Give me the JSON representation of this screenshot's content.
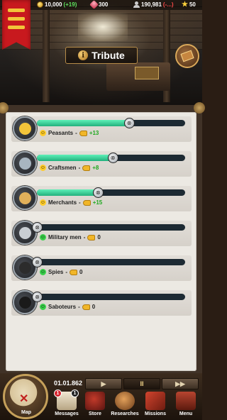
{
  "top_bar": {
    "gold": "10,000",
    "gold_delta": "(+19)",
    "gems": "300",
    "population": "190,981",
    "population_delta": "(-...)",
    "stars": "50"
  },
  "header": {
    "title": "Tribute"
  },
  "classes": [
    {
      "name": "Peasants",
      "mood": "yellow",
      "value": "+13",
      "level": 0.62
    },
    {
      "name": "Craftsmen",
      "mood": "yellow",
      "value": "+8",
      "level": 0.51
    },
    {
      "name": "Merchants",
      "mood": "yellow",
      "value": "+15",
      "level": 0.41
    },
    {
      "name": "Military men",
      "mood": "green",
      "value": "0",
      "level": 0.0
    },
    {
      "name": "Spies",
      "mood": "green",
      "value": "0",
      "level": 0.0
    },
    {
      "name": "Saboteurs",
      "mood": "green",
      "value": "0",
      "level": 0.0
    }
  ],
  "bottom": {
    "date": "01.01.862",
    "speed_pause": "▶",
    "speed_normal": "II",
    "speed_fast": "▶▶",
    "map_label": "Map",
    "nav": [
      {
        "label": "Messages",
        "icon": "scroll-icon",
        "badge_left": "1",
        "badge_right": "1"
      },
      {
        "label": "Store",
        "icon": "chest-icon"
      },
      {
        "label": "Researches",
        "icon": "research-icon"
      },
      {
        "label": "Missions",
        "icon": "missions-icon"
      },
      {
        "label": "Menu",
        "icon": "menu-icon"
      }
    ]
  },
  "colors": {
    "bar_fill": "#22b07c",
    "bar_track": "#1d2a33",
    "positive": "#1fa81f",
    "banner": "#c8191e"
  }
}
